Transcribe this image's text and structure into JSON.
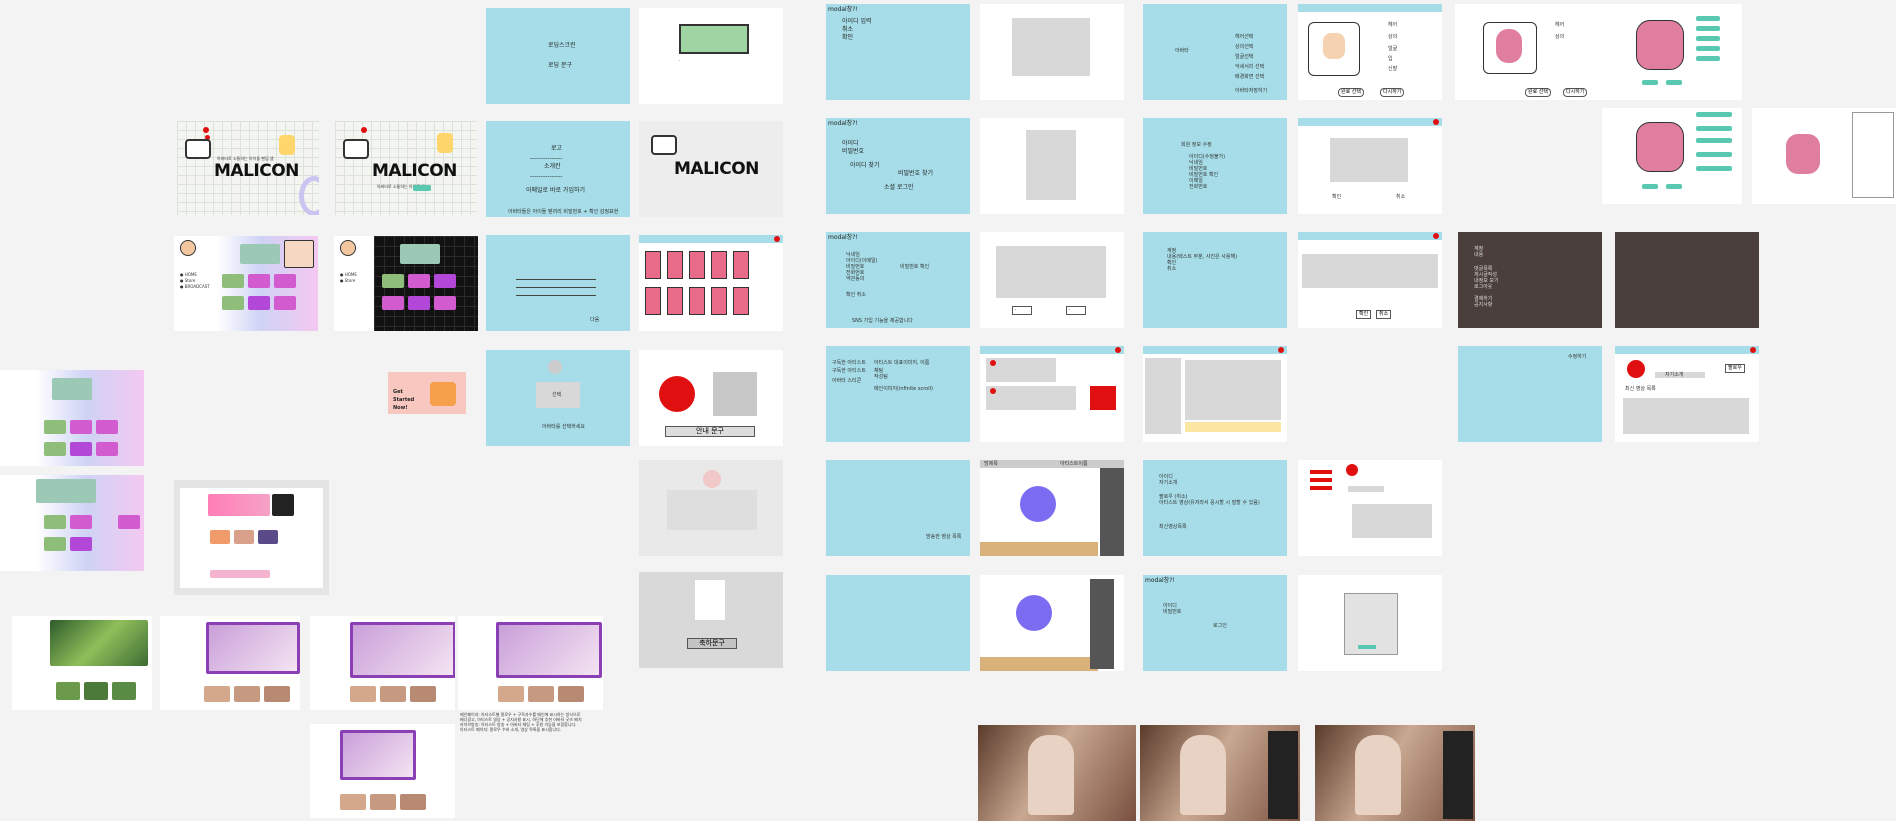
{
  "colors": {
    "cyan": "#a6dde8",
    "red": "#e01010",
    "purple": "#7b6cf2",
    "dark": "#4a3f3c",
    "teal": "#58c9b0"
  },
  "canvas": {
    "name": "wireframe-board"
  },
  "logo": {
    "text": "MALICON",
    "sub1": "아바타로 소통하는 아이돌 팬덤 앱",
    "sub2": "아바타로 소통하는 아이돌 앱"
  },
  "frames": {
    "splash": {
      "line1": "로딩스크린",
      "line2": "로딩 문구"
    },
    "login": {
      "title": "로고",
      "field": "소개칸",
      "sep": "---------------",
      "cta": "이메일로 바로 가입하기",
      "footer": "아바타들은 아이돌 팬끼리 비밀번호 + 확인 감정표현"
    },
    "onboarding": {
      "caption": "아바타를 선택하세요",
      "label": "선택",
      "bottom": "다음"
    },
    "modal1": {
      "title": "modal창?!",
      "items": [
        "아이디 입력",
        "취소",
        "확인"
      ]
    },
    "modal2": {
      "title": "modal창?!",
      "items": [
        "아이디",
        "비밀번호",
        "아이디 찾기",
        "비밀번호 찾기",
        "소셜 로그인"
      ]
    },
    "modal3": {
      "title": "modal창?!",
      "items": [
        "닉네임",
        "아이디(이메일)",
        "비밀번호",
        "비밀번호 확인",
        "전화번호",
        "약관동의",
        "확인 취소"
      ],
      "sns": "SNS 가입 기능을 제공합니다"
    },
    "nick_screen": {
      "left": "아바타",
      "items": [
        "헤어선택",
        "상의선택",
        "얼굴선택",
        "악세서리 선택",
        "배경화면 선택",
        "아바타저장하기"
      ]
    },
    "profile_edit": {
      "title": "회원 정보 수정",
      "items": [
        "아이디(수정불가)",
        "닉네임",
        "비밀번호",
        "비밀번호 확인",
        "이메일",
        "전화번호"
      ]
    },
    "cards": {
      "items": [
        "계정",
        "내용(텍스트 부분, 사진은 사용해)",
        "확인",
        "취소"
      ]
    },
    "avatar_labels": {
      "items": [
        "헤어",
        "상의",
        "얼굴",
        "입",
        "신발",
        "악세서리",
        "배경"
      ],
      "btn1": "완료 선택",
      "btn2": "다시하기"
    },
    "dark": {
      "items": [
        "계정",
        "내용",
        "댓글목록",
        "게시글작성",
        "내정보 보기",
        "로그아웃",
        "결제하기",
        "공지사항"
      ]
    },
    "profile": {
      "title": "수정하기",
      "name": "팔로우",
      "caption": "자기소개",
      "sub": "최신 영상 목록"
    },
    "feed_notes": {
      "left": [
        "구독한 아티스트",
        "구독한 아티스트",
        "아바타 스티콘"
      ],
      "right": [
        "아티스트 대표이미지, 이름",
        "채팅",
        "작성팀"
      ],
      "scroll": "메인이미지(infinite scroll)"
    },
    "live": {
      "title": "방제목",
      "right": "아티스트이름",
      "badge": "팔로우"
    },
    "live_notes": {
      "left": [
        "아이디",
        "자기소개",
        "팔로우 (취소)",
        "아티스트 영상(유저라서 응시할 시 말할 수 있음)"
      ],
      "extra": "최신영상목록",
      "bottom": "방송한 영상 목록"
    },
    "modal4": {
      "title": "modal창?!",
      "items": [
        "아이디",
        "비밀번호",
        "아이디 찾기",
        "비밀번호 찾기",
        "로그인"
      ]
    },
    "banner": {
      "title": "Get Started Now!"
    },
    "guide": {
      "text": "안내 문구"
    },
    "congrats": {
      "text": "축하문구"
    },
    "notes": {
      "lines": [
        "메인페이지: 아티스트별 팔로우 + 구독자수를 메인에 표시하는 방식으로",
        "배너광고, 아티스트 영상 + 공지사항 표시, 하단에 추천 아바타 굿즈 배치",
        "라이브방송: 아티스트 방송 + 아바타 채팅 + 후원 기능을 포함합니다.",
        "아티스트 페이지: 팔로우 수와 소개, 영상 목록을 표시합니다."
      ]
    }
  }
}
